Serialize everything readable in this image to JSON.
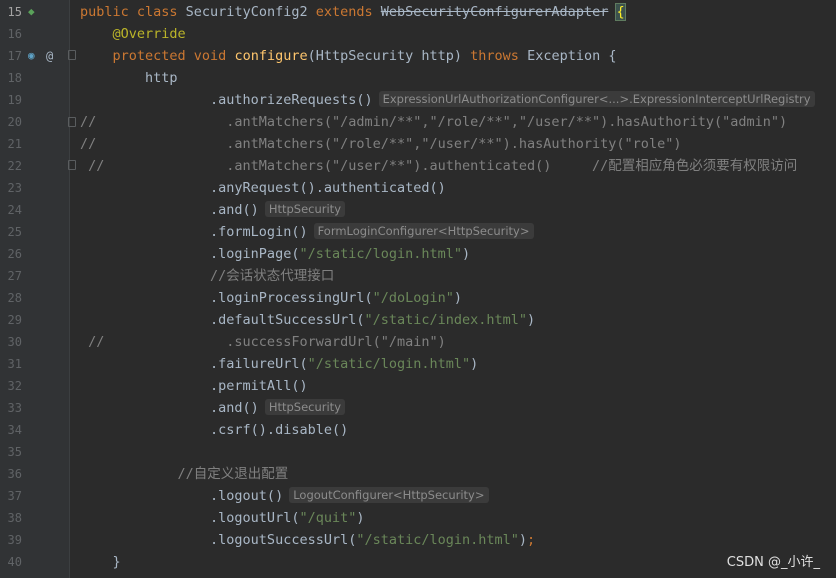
{
  "watermark": "CSDN @_小许_",
  "hints": {
    "h19": "ExpressionUrlAuthorizationConfigurer<...>.ExpressionInterceptUrlRegistry",
    "h24": "HttpSecurity",
    "h25": "FormLoginConfigurer<HttpSecurity>",
    "h33": "HttpSecurity",
    "h37": "LogoutConfigurer<HttpSecurity>"
  },
  "lines": [
    {
      "num": "15",
      "parts": [
        [
          "kw",
          "public class "
        ],
        [
          "",
          "SecurityConfig2 "
        ],
        [
          "kw",
          "extends "
        ],
        [
          "strike",
          "WebSecurityConfigurerAdapter"
        ],
        [
          "",
          " "
        ],
        [
          "brace-hl",
          "{"
        ]
      ]
    },
    {
      "num": "16",
      "parts": [
        [
          "ann",
          "    @Override"
        ]
      ]
    },
    {
      "num": "17",
      "parts": [
        [
          "kw",
          "    protected void "
        ],
        [
          "fn",
          "configure"
        ],
        [
          "",
          "(HttpSecurity http) "
        ],
        [
          "kw",
          "throws "
        ],
        [
          "",
          "Exception {"
        ]
      ]
    },
    {
      "num": "18",
      "parts": [
        [
          "",
          "        http"
        ]
      ]
    },
    {
      "num": "19",
      "parts": [
        [
          "",
          "                .authorizeRequests()"
        ]
      ],
      "hint": "h19"
    },
    {
      "num": "20",
      "parts": [
        [
          "cm",
          "//                .antMatchers(\"/admin/**\",\"/role/**\",\"/user/**\").hasAuthority(\"admin\")"
        ]
      ]
    },
    {
      "num": "21",
      "parts": [
        [
          "cm",
          "//                .antMatchers(\"/role/**\",\"/user/**\").hasAuthority(\"role\")"
        ]
      ]
    },
    {
      "num": "22",
      "parts": [
        [
          "cm",
          " //               .antMatchers(\"/user/**\").authenticated()     //配置相应角色必须要有权限访问"
        ]
      ]
    },
    {
      "num": "23",
      "parts": [
        [
          "",
          "                .anyRequest().authenticated()"
        ]
      ]
    },
    {
      "num": "24",
      "parts": [
        [
          "",
          "                .and()"
        ]
      ],
      "hint": "h24"
    },
    {
      "num": "25",
      "parts": [
        [
          "",
          "                .formLogin()"
        ]
      ],
      "hint": "h25"
    },
    {
      "num": "26",
      "parts": [
        [
          "",
          "                .loginPage("
        ],
        [
          "str",
          "\"/static/login.html\""
        ],
        [
          "",
          ")"
        ]
      ]
    },
    {
      "num": "27",
      "parts": [
        [
          "cm",
          "                //会话状态代理接口"
        ]
      ]
    },
    {
      "num": "28",
      "parts": [
        [
          "",
          "                .loginProcessingUrl("
        ],
        [
          "str",
          "\"/doLogin\""
        ],
        [
          "",
          ")"
        ]
      ]
    },
    {
      "num": "29",
      "parts": [
        [
          "",
          "                .defaultSuccessUrl("
        ],
        [
          "str",
          "\"/static/index.html\""
        ],
        [
          "",
          ")"
        ]
      ]
    },
    {
      "num": "30",
      "parts": [
        [
          "cm",
          " //               .successForwardUrl(\"/main\")"
        ]
      ]
    },
    {
      "num": "31",
      "parts": [
        [
          "",
          "                .failureUrl("
        ],
        [
          "str",
          "\"/static/login.html\""
        ],
        [
          "",
          ")"
        ]
      ]
    },
    {
      "num": "32",
      "parts": [
        [
          "",
          "                .permitAll()"
        ]
      ]
    },
    {
      "num": "33",
      "parts": [
        [
          "",
          "                .and()"
        ]
      ],
      "hint": "h33"
    },
    {
      "num": "34",
      "parts": [
        [
          "",
          "                .csrf().disable()"
        ]
      ]
    },
    {
      "num": "35",
      "parts": [
        [
          "",
          ""
        ]
      ]
    },
    {
      "num": "36",
      "parts": [
        [
          "cm",
          "            //自定义退出配置"
        ]
      ]
    },
    {
      "num": "37",
      "parts": [
        [
          "",
          "                .logout()"
        ]
      ],
      "hint": "h37"
    },
    {
      "num": "38",
      "parts": [
        [
          "",
          "                .logoutUrl("
        ],
        [
          "str",
          "\"/quit\""
        ],
        [
          "",
          ")"
        ]
      ]
    },
    {
      "num": "39",
      "parts": [
        [
          "",
          "                .logoutSuccessUrl("
        ],
        [
          "str",
          "\"/static/login.html\""
        ],
        [
          "",
          ")"
        ],
        [
          "kw",
          ";"
        ]
      ]
    },
    {
      "num": "40",
      "parts": [
        [
          "",
          "    }"
        ]
      ]
    }
  ]
}
